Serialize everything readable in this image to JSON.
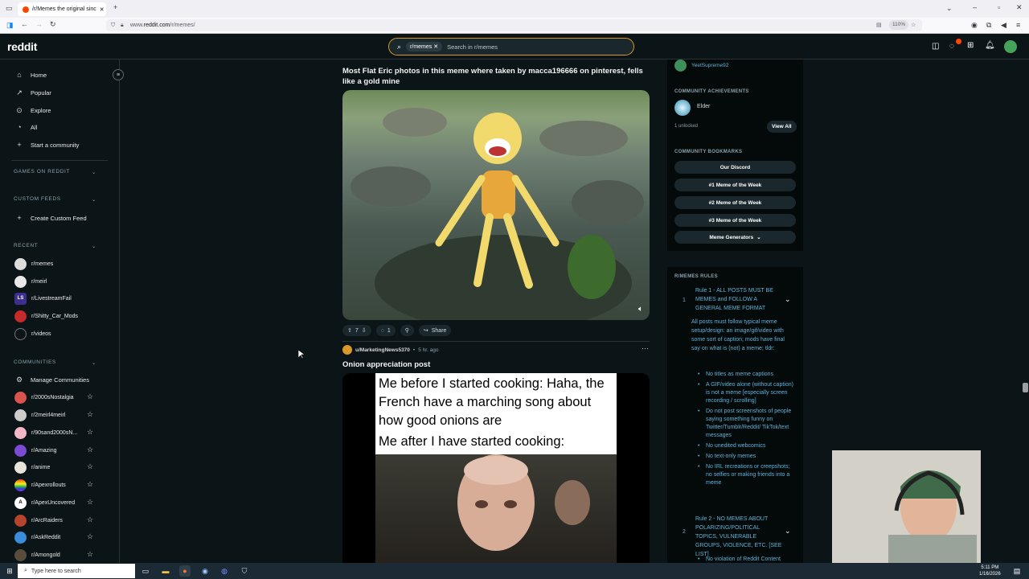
{
  "browser": {
    "tab_title": "/r/Memes the original sinc",
    "url_prefix": "www.",
    "url_host": "reddit.com",
    "url_path": "/r/memes/",
    "zoom": "110%"
  },
  "header": {
    "logo": "reddit",
    "search_chip": "r/memes",
    "search_placeholder": "Search in r/memes"
  },
  "sidebar": {
    "nav": [
      {
        "label": "Home",
        "icon": "home-icon"
      },
      {
        "label": "Popular",
        "icon": "popular-icon"
      },
      {
        "label": "Explore",
        "icon": "explore-icon"
      },
      {
        "label": "All",
        "icon": "all-icon"
      },
      {
        "label": "Start a community",
        "icon": "plus-icon"
      }
    ],
    "games_header": "GAMES ON REDDIT",
    "custom_header": "CUSTOM FEEDS",
    "create_feed": "Create Custom Feed",
    "recent_header": "RECENT",
    "recent": [
      "r/memes",
      "r/meirl",
      "r/LivestreamFail",
      "r/Shitty_Car_Mods",
      "r/videos"
    ],
    "communities_header": "COMMUNITIES",
    "manage": "Manage Communities",
    "communities": [
      "r/2000sNostalgia",
      "r/2meirl4meirl",
      "r/90sand2000sN...",
      "r/Amazing",
      "r/anime",
      "r/Apexrollouts",
      "r/ApexUncovered",
      "r/ArcRaiders",
      "r/AskReddit",
      "r/Amongold"
    ]
  },
  "post1": {
    "title": "Most Flat Eric photos in this meme where taken by macca196666 on pinterest, fells like a gold mine",
    "votes": "7",
    "comments": "1",
    "share": "Share"
  },
  "post2": {
    "author": "u/MarketingNews5370",
    "time": "5 hr. ago",
    "title": "Onion appreciation post",
    "meme_top": "Me before I started cooking: Haha, the French have a marching song about how good onions are",
    "meme_bottom": "Me after I have started cooking:"
  },
  "right": {
    "user": "YeetSupreme92",
    "achievements_header": "COMMUNITY ACHIEVEMENTS",
    "achievement": "Elder",
    "unlocked": "1 unlocked",
    "view_all": "View All",
    "bookmarks_header": "COMMUNITY BOOKMARKS",
    "bookmarks": [
      "Our Discord",
      "#1 Meme of the Week",
      "#2 Meme of the Week",
      "#3 Meme of the Week",
      "Meme Generators"
    ],
    "rules_header": "R/MEMES RULES",
    "rule1_num": "1",
    "rule1_title": "Rule 1 - ALL POSTS MUST BE MEMES and FOLLOW A GENERAL MEME FORMAT",
    "rule1_body": "All posts must follow typical meme setup/design: an image/gif/video with some sort of caption; mods have final say on what is (not) a meme; tldr:",
    "rule1_bullets": [
      "No titles as meme captions",
      "A GIF/video alone (without caption) is not a meme [especially screen recording / scrolling]",
      "Do not post screenshots of people saying something funny on Twitter/Tumblr/Reddit/ TikTok/text messages",
      "No unedited webcomics",
      "No text-only memes",
      "No IRL recreations or creepshots; no selfies or making friends into a meme"
    ],
    "rule2_num": "2",
    "rule2_title": "Rule 2 - NO MEMES ABOUT POLARIZING/POLITICAL TOPICS, VULNERABLE GROUPS, VIOLENCE, ETC. [SEE LIST]",
    "rule2_bullet": "No violation of Reddit Content"
  },
  "taskbar": {
    "search": "Type here to search",
    "time": "5:11 PM",
    "date": "1/16/2026"
  },
  "colors": {
    "accent": "#d79a1d",
    "bg": "#0b1416",
    "rule_text": "#5fb3d9"
  }
}
